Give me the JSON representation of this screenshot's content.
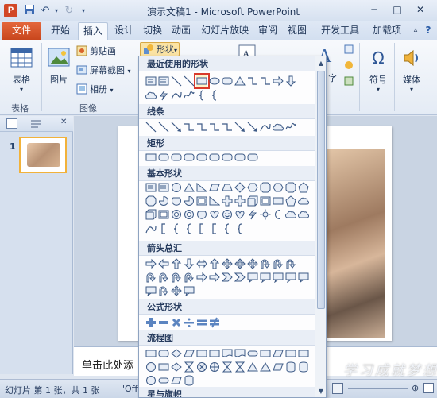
{
  "window": {
    "title": "演示文稿1 - Microsoft PowerPoint",
    "app_icon_letter": "P"
  },
  "tabs": [
    {
      "label": "文件",
      "kind": "file"
    },
    {
      "label": "开始"
    },
    {
      "label": "插入",
      "active": true
    },
    {
      "label": "设计"
    },
    {
      "label": "切换"
    },
    {
      "label": "动画"
    },
    {
      "label": "幻灯片放映"
    },
    {
      "label": "审阅"
    },
    {
      "label": "视图"
    },
    {
      "label": "开发工具"
    },
    {
      "label": "加载项"
    }
  ],
  "ribbon": {
    "table_label": "表格",
    "picture_label": "图片",
    "clipart_label": "剪贴画",
    "screenshot_label": "屏幕截图",
    "album_label": "相册",
    "shapes_label": "形状",
    "symbol_label": "符号",
    "media_label": "媒体",
    "group_tables": "表格",
    "group_images": "图像",
    "partial_char": "字"
  },
  "shapes_menu": {
    "sections": [
      {
        "title": "最近使用的形状"
      },
      {
        "title": "线条"
      },
      {
        "title": "矩形"
      },
      {
        "title": "基本形状"
      },
      {
        "title": "箭头总汇"
      },
      {
        "title": "公式形状"
      },
      {
        "title": "流程图"
      },
      {
        "title": "星与旗帜"
      }
    ],
    "selected_shape": "rectangle"
  },
  "slide_pane": {
    "slide_number": "1"
  },
  "notes": {
    "placeholder": "单击此处添"
  },
  "status": {
    "slide_info": "幻灯片 第 1 张，共 1 张",
    "theme": "\"Offi"
  },
  "watermark": "学习成就梦想",
  "colors": {
    "file_tab": "#d24726",
    "selection_outline": "#d93a2b",
    "thumb_border": "#f2b23a"
  }
}
